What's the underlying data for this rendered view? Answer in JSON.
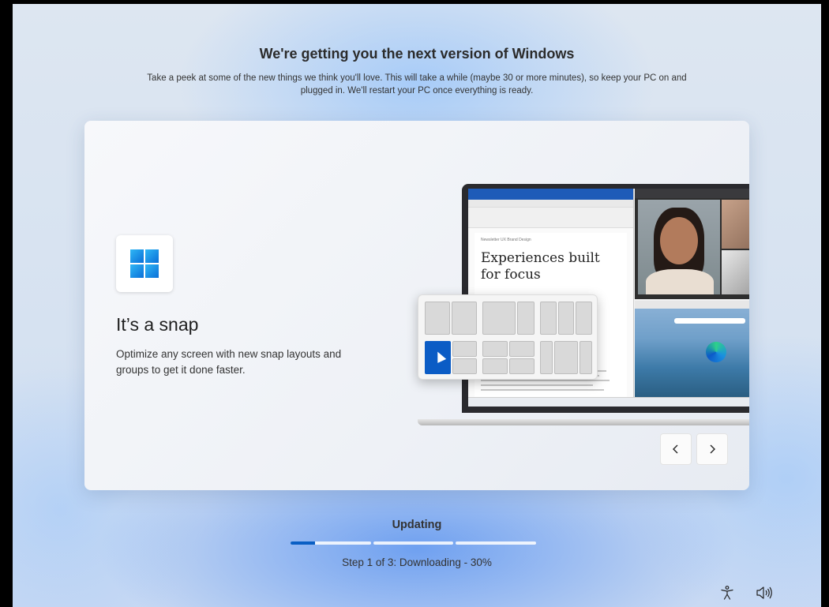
{
  "header": {
    "title": "We're getting you the next version of Windows",
    "subtitle": "Take a peek at some of the new things we think you'll love. This will take a while (maybe 30 or more minutes), so keep your PC on and plugged in. We'll restart your PC once everything is ready."
  },
  "feature": {
    "title": "It’s a snap",
    "description": "Optimize any screen with new snap layouts and groups to get it done faster.",
    "icon": "windows-logo-icon"
  },
  "illustration": {
    "doc_title": "Experiences built for focus",
    "doc_header": "Newsletter    UX Brand Design"
  },
  "carousel": {
    "prev_icon": "chevron-left-icon",
    "next_icon": "chevron-right-icon"
  },
  "progress": {
    "status": "Updating",
    "step_text": "Step 1 of 3: Downloading - 30%",
    "segments": 3,
    "current_segment_fill": 0.3,
    "accent": "#0a5fc4"
  },
  "system": {
    "accessibility_icon": "accessibility-icon",
    "volume_icon": "volume-icon"
  }
}
